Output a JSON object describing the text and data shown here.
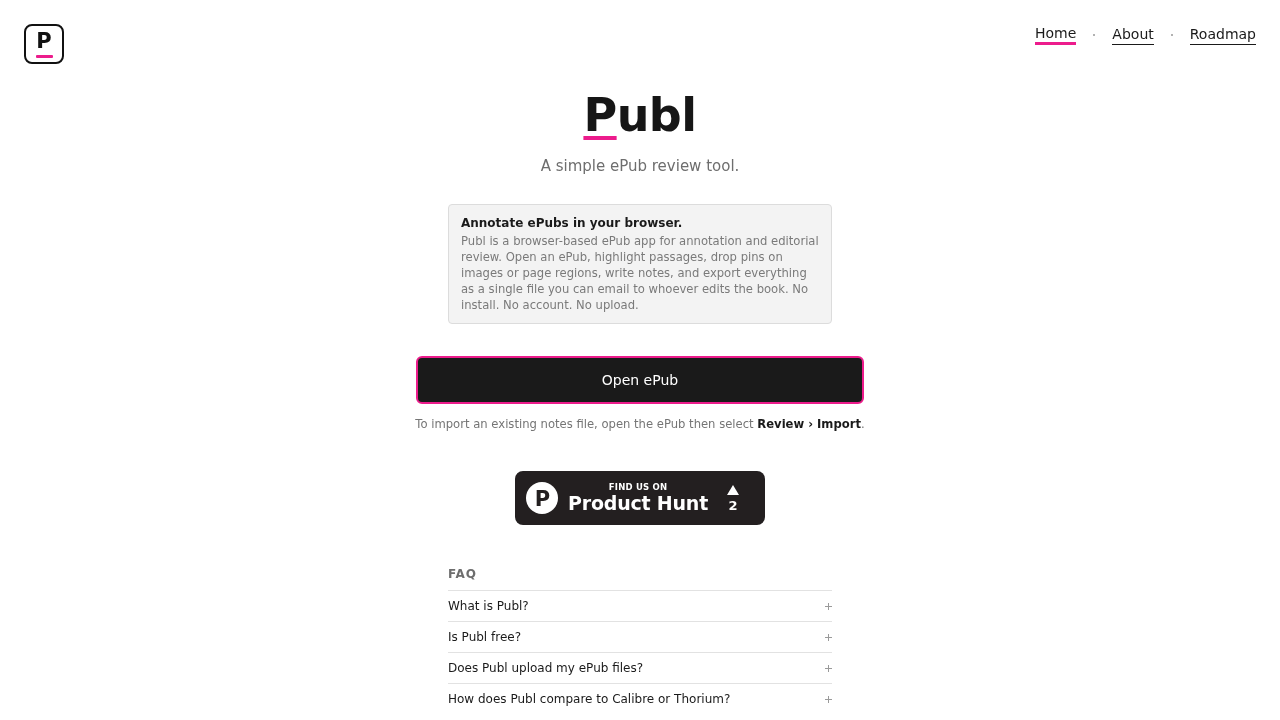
{
  "logo": {
    "letter": "P"
  },
  "nav": [
    {
      "label": "Home",
      "selected": true
    },
    {
      "label": "About",
      "selected": false
    },
    {
      "label": "Roadmap",
      "selected": false
    }
  ],
  "hero": {
    "title_accent": "P",
    "title_rest": "ubl",
    "subtitle": "A simple ePub review tool."
  },
  "info_card": {
    "title": "Annotate ePubs in your browser.",
    "text": "Publ is a browser-based ePub app for annotation and editorial review. Open an ePub, highlight passages, drop pins on images or page regions, write notes, and export everything as a single file you can email to whoever edits the book. No install. No account. No upload."
  },
  "primary_button": {
    "label": "Open ePub"
  },
  "import_hint": "To import an existing notes file, open the ePub then select **Review › Import**.",
  "product_hunt": {
    "logo_letter": "P",
    "eyebrow": "FIND US ON",
    "name": "Product Hunt",
    "votes": "2"
  },
  "faq": {
    "heading": "FAQ",
    "items": [
      {
        "question": "What is Publ?",
        "expanded": false
      },
      {
        "question": "Is Publ free?",
        "expanded": false
      },
      {
        "question": "Does Publ upload my ePub files?",
        "expanded": false
      },
      {
        "question": "How does Publ compare to Calibre or Thorium?",
        "expanded": false
      }
    ]
  }
}
